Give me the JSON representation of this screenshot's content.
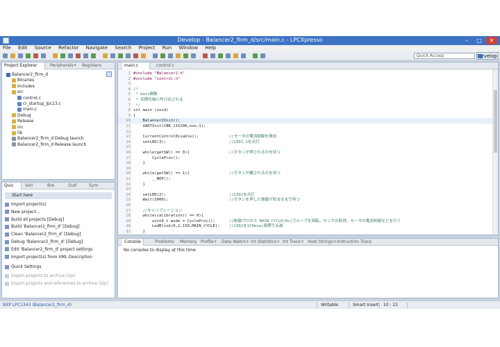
{
  "window": {
    "title": "Develop - Balancer2_firm_d/src/main.c - LPCXpresso",
    "min": "–",
    "max": "□",
    "close": "✕"
  },
  "menu": [
    "File",
    "Edit",
    "Source",
    "Refactor",
    "Navigate",
    "Search",
    "Project",
    "Run",
    "Window",
    "Help"
  ],
  "toolbar": {
    "quick_access_placeholder": "Quick Access",
    "perspective": "Develop"
  },
  "project_explorer": {
    "tabs": [
      "Project Explorer",
      "Peripherals+",
      "Registers"
    ],
    "tree": [
      {
        "label": "Balancer2_firm_d",
        "depth": 0,
        "icon": "project"
      },
      {
        "label": "Binaries",
        "depth": 1,
        "icon": "folder"
      },
      {
        "label": "Includes",
        "depth": 1,
        "icon": "folder"
      },
      {
        "label": "src",
        "depth": 1,
        "icon": "folder"
      },
      {
        "label": "control.c",
        "depth": 2,
        "icon": "file-c"
      },
      {
        "label": "cr_startup_lpc13.c",
        "depth": 2,
        "icon": "file-c"
      },
      {
        "label": "main.c",
        "depth": 2,
        "icon": "file-c"
      },
      {
        "label": "Debug",
        "depth": 1,
        "icon": "folder"
      },
      {
        "label": "Release",
        "depth": 1,
        "icon": "folder"
      },
      {
        "label": "inc",
        "depth": 1,
        "icon": "folder"
      },
      {
        "label": "lib",
        "depth": 1,
        "icon": "folder"
      },
      {
        "label": "Balancer2_firm_d Debug.launch",
        "depth": 1,
        "icon": "file"
      },
      {
        "label": "Balancer2_firm_d Release.launch",
        "depth": 1,
        "icon": "file"
      }
    ]
  },
  "quickstart": {
    "tabs": [
      "Quic",
      "Vari",
      "Bre",
      "Outl",
      "Sym"
    ],
    "header": "Start here",
    "items": [
      {
        "label": "Import project(s)",
        "enabled": true
      },
      {
        "label": "New project...",
        "enabled": true
      },
      {
        "label": "Build all projects [Debug]",
        "enabled": true
      },
      {
        "label": "Build 'Balancer2_firm_d' [Debug]",
        "enabled": true
      },
      {
        "label": "Clean 'Balancer2_firm_d' [Debug]",
        "enabled": true
      },
      {
        "label": "Debug 'Balancer2_firm_d' [Debug]",
        "enabled": true
      },
      {
        "label": "Edit 'Balancer2_firm_d' project settings",
        "enabled": true
      },
      {
        "label": "Import project(s) from XML Description",
        "enabled": true
      },
      {
        "label": "Quick Settings",
        "enabled": true
      },
      {
        "label": "Export projects to archive (zip)",
        "enabled": false
      },
      {
        "label": "Export projects and references to archive (zip)",
        "enabled": false
      }
    ]
  },
  "editor": {
    "tabs": [
      "main.c",
      "control.c"
    ],
    "lines": [
      {
        "n": "1",
        "code": "#include \"Balancer2.h\"",
        "comment": ""
      },
      {
        "n": "2",
        "code": "#include \"control.h\"",
        "comment": ""
      },
      {
        "n": "3",
        "code": "",
        "comment": ""
      },
      {
        "n": "4",
        "code": "/*",
        "comment": ""
      },
      {
        "n": "5",
        "code": " * main関数",
        "comment": ""
      },
      {
        "n": "6",
        "code": " * 初期化後に呼び出される",
        "comment": ""
      },
      {
        "n": "7",
        "code": " */",
        "comment": ""
      },
      {
        "n": "8",
        "code": "int main (void)",
        "comment": ""
      },
      {
        "n": "9",
        "code": "{",
        "comment": ""
      },
      {
        "n": "10",
        "code": "    Balancer2Init();",
        "comment": ""
      },
      {
        "n": "11",
        "code": "    UARTInit(CBR_115200,non,1);",
        "comment": ""
      },
      {
        "n": "12",
        "code": "",
        "comment": ""
      },
      {
        "n": "13",
        "code": "    CurrentControlDisable();",
        "comment": "//モータの電流制御を無効"
      },
      {
        "n": "14",
        "code": "    setLED(3);",
        "comment": "//LED1,2を点灯"
      },
      {
        "n": "15",
        "code": "",
        "comment": ""
      },
      {
        "n": "16",
        "code": "    while(getSW() == 0){",
        "comment": "//ボタンが押されるのを待つ"
      },
      {
        "n": "17",
        "code": "        CycleProc();",
        "comment": ""
      },
      {
        "n": "18",
        "code": "    }",
        "comment": ""
      },
      {
        "n": "19",
        "code": "",
        "comment": ""
      },
      {
        "n": "20",
        "code": "    while(getSW() == 1){",
        "comment": "//ボタンが離されるのを待つ"
      },
      {
        "n": "21",
        "code": "        __NOP();",
        "comment": ""
      },
      {
        "n": "22",
        "code": "    }",
        "comment": ""
      },
      {
        "n": "23",
        "code": "",
        "comment": ""
      },
      {
        "n": "24",
        "code": "    setLED(2);",
        "comment": "//LED2を点灯"
      },
      {
        "n": "25",
        "code": "    Wait(1000);",
        "comment": "//ボタンを押した振動が収まるまで待つ"
      },
      {
        "n": "26",
        "code": "",
        "comment": ""
      },
      {
        "n": "27",
        "code": "    //キャリブレーション",
        "comment": ""
      },
      {
        "n": "28",
        "code": "    while(calibration() == 0){",
        "comment": ""
      },
      {
        "n": "29",
        "code": "        uint8_t mode = CycleProc();",
        "comment": "//制御プロセス MAIN_CYCLE[Hz]でループを回転。センサの取得、モータの電流制御などを行う"
      },
      {
        "n": "30",
        "code": "        LedBlink(0,2,150,MAIN_CYCLE);",
        "comment": "//LED2を150msec周期で点滅"
      },
      {
        "n": "31",
        "code": "    }",
        "comment": ""
      }
    ]
  },
  "console": {
    "tabs": [
      "Console",
      "Problems",
      "Memory",
      "Profile+",
      "Data Watch+",
      "Int Statistics+",
      "Int Trace+",
      "Host Strings+",
      "Instruction Trace"
    ],
    "message": "No consoles to display at this time."
  },
  "status": {
    "left": "NXP LPC1343  (Balancer2_firm_d)",
    "writable": "Writable",
    "insert": "Smart Insert",
    "position": "10 : 21"
  }
}
